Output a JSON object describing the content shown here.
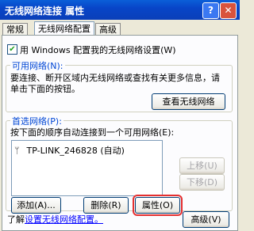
{
  "window": {
    "title": "无线网络连接 属性",
    "help": "?",
    "close": "✕"
  },
  "tabs": [
    {
      "label": "常规"
    },
    {
      "label": "无线网络配置"
    },
    {
      "label": "高级"
    }
  ],
  "use_windows_checkbox": {
    "label": "用 Windows 配置我的无线网络设置(W)",
    "checked": true
  },
  "available": {
    "legend": "可用网络(N):",
    "description": "要连接、断开区域内无线网络或查找有关更多信息，请单击下面的按钮。",
    "view_button": "查看无线网络"
  },
  "preferred": {
    "legend": "首选网络(P):",
    "description": "按下面的顺序自动连接到一个可用网络(E):",
    "networks": [
      {
        "name": "TP-LINK_246828 (自动)"
      }
    ],
    "move_up": "上移(U)",
    "move_down": "下移(D)",
    "add": "添加(A)...",
    "remove": "删除(R)",
    "properties": "属性(O)"
  },
  "footer": {
    "learn_prefix": "了解",
    "learn_link": "设置无线网络配置。",
    "advanced": "高级(V)"
  },
  "colors": {
    "titlebar": "#0a45c8",
    "highlight_border": "#e53030"
  }
}
